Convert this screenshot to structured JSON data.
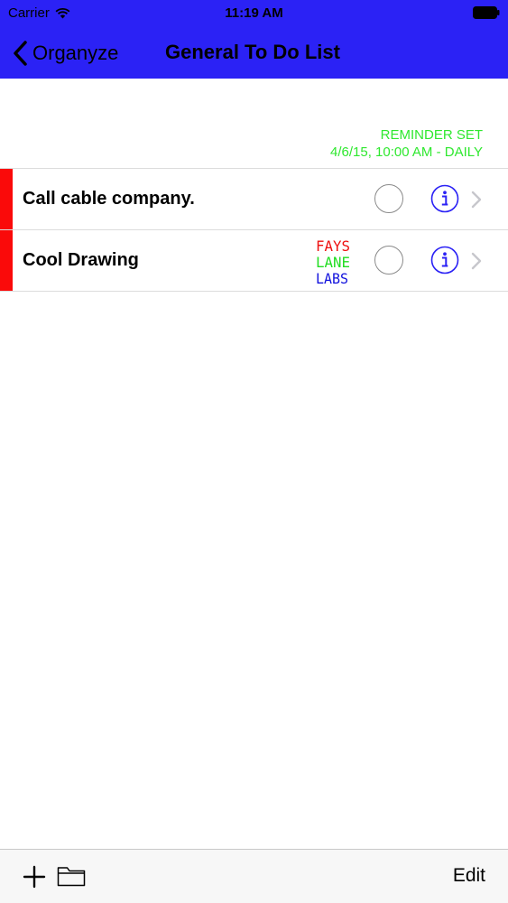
{
  "status_bar": {
    "carrier": "Carrier",
    "time": "11:19 AM"
  },
  "nav": {
    "back_label": "Organyze",
    "title": "General To Do List"
  },
  "reminder": {
    "line1": "REMINDER SET",
    "line2": "4/6/15, 10:00 AM - DAILY",
    "color": "#2fe82f"
  },
  "list": {
    "items": [
      {
        "title": "Call cable company.",
        "has_drawing": false,
        "bar_color": "#fa0a0a"
      },
      {
        "title": "Cool Drawing",
        "has_drawing": true,
        "bar_color": "#fa0a0a"
      }
    ]
  },
  "drawing": {
    "line1": "FAYS",
    "line2": "LANE",
    "line3": "LABS"
  },
  "toolbar": {
    "edit_label": "Edit",
    "add_icon": "plus-icon",
    "folder_icon": "folder-icon"
  },
  "colors": {
    "nav_background": "#2b22f5",
    "accent_blue": "#2b22f5"
  }
}
